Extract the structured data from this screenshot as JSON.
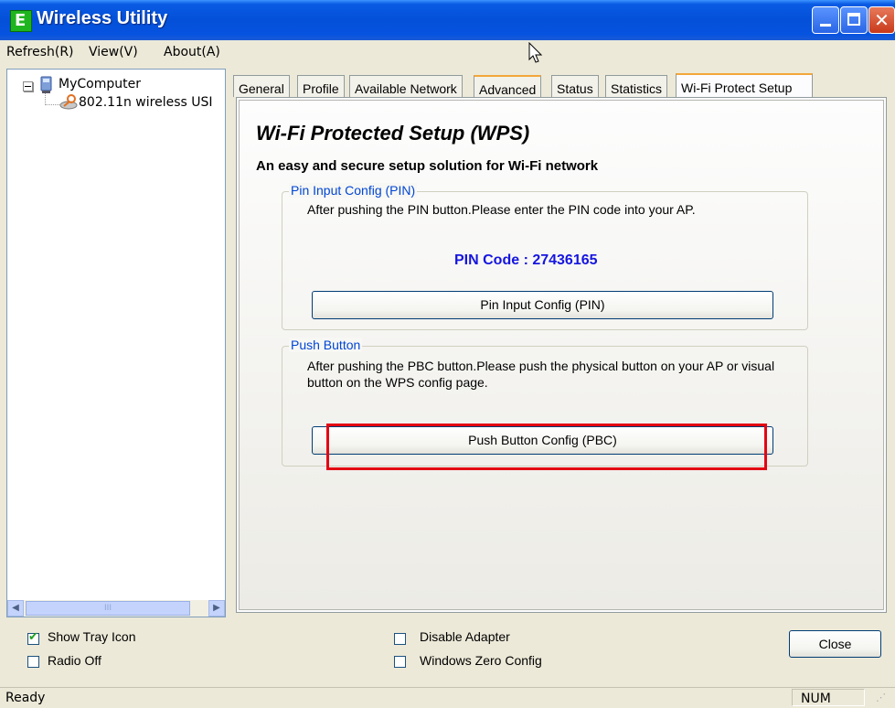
{
  "window": {
    "title": "Wireless Utility",
    "app_icon_glyph": "E"
  },
  "menu": [
    {
      "label": "Refresh(R)"
    },
    {
      "label": "View(V)"
    },
    {
      "label": "About(A)"
    }
  ],
  "tree": {
    "expander": "⊟",
    "root": "MyComputer",
    "adapter": "802.11n wireless USI"
  },
  "tabs": [
    {
      "label": "General"
    },
    {
      "label": "Profile"
    },
    {
      "label": "Available Network"
    },
    {
      "label": "Advanced"
    },
    {
      "label": "Status"
    },
    {
      "label": "Statistics"
    },
    {
      "label": "Wi-Fi Protect Setup"
    }
  ],
  "wps": {
    "title": "Wi-Fi Protected Setup (WPS)",
    "subtitle": "An easy and secure setup solution for Wi-Fi network",
    "pin_group": {
      "label": "Pin Input Config (PIN)",
      "description": "After pushing the PIN button.Please enter the PIN code into your AP.",
      "pin_code": "PIN Code :  27436165",
      "button": "Pin Input Config (PIN)"
    },
    "pbc_group": {
      "label": "Push Button",
      "description": "After pushing the PBC button.Please push the physical button on your AP or visual button on the WPS config page.",
      "button": "Push Button Config (PBC)"
    }
  },
  "options": {
    "show_tray_icon": {
      "label": "Show Tray Icon",
      "checked": true,
      "mark": "✔"
    },
    "radio_off": {
      "label": "Radio Off",
      "checked": false
    },
    "disable_adapter": {
      "label": "Disable Adapter",
      "checked": false
    },
    "windows_zero_config": {
      "label": "Windows Zero Config",
      "checked": false
    }
  },
  "close_button": "Close",
  "status": {
    "text": "Ready",
    "num": "NUM"
  },
  "colors": {
    "title_bar": "#0450d8",
    "tab_accent": "#f3a63a",
    "pin_code": "#1515e0",
    "group_label": "#0046d5",
    "highlight": "#e30613"
  }
}
